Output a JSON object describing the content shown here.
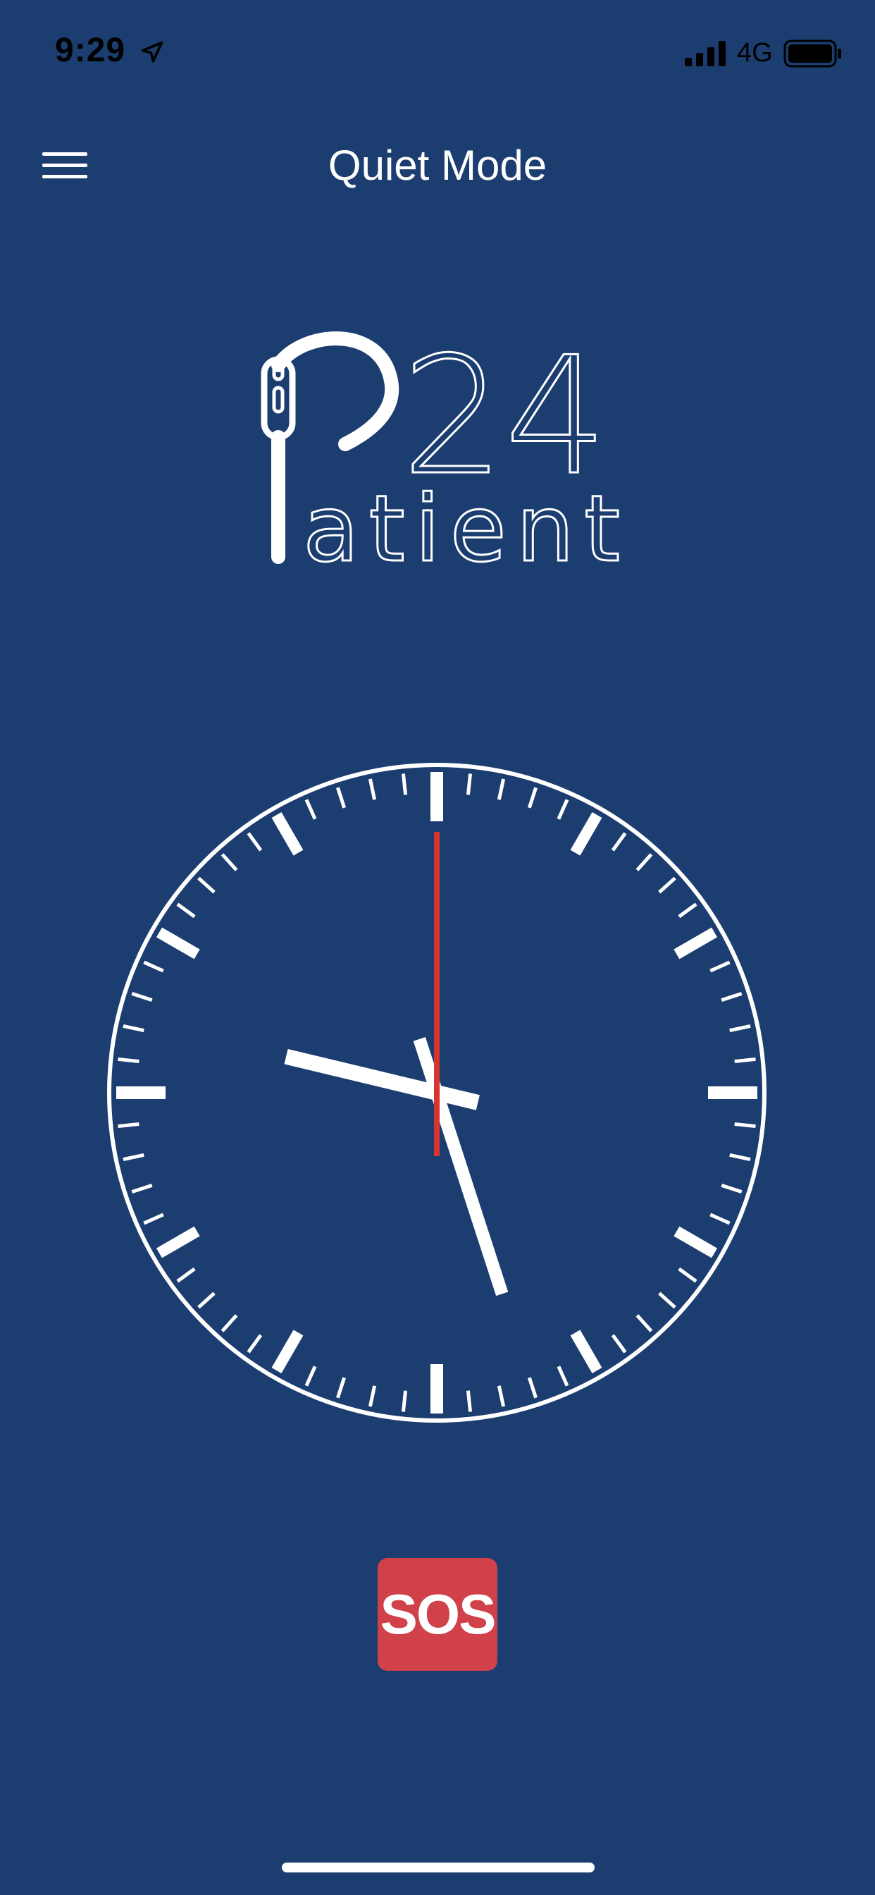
{
  "status_bar": {
    "time": "9:29",
    "network": "4G",
    "icons": [
      "location-arrow-icon",
      "cellular-signal-icon",
      "battery-icon"
    ]
  },
  "header": {
    "title": "Quiet Mode",
    "menu_icon": "hamburger-menu-icon"
  },
  "logo": {
    "number": "24",
    "word": "atient"
  },
  "clock": {
    "time_shown": {
      "hour": 9,
      "minute": 27,
      "second": 0
    },
    "colors": {
      "face_marks": "#ffffff",
      "second_hand": "#d9352f"
    }
  },
  "sos": {
    "label": "SOS",
    "color": "#d0414a"
  },
  "colors": {
    "background": "#1b3d70",
    "text": "#ffffff"
  }
}
